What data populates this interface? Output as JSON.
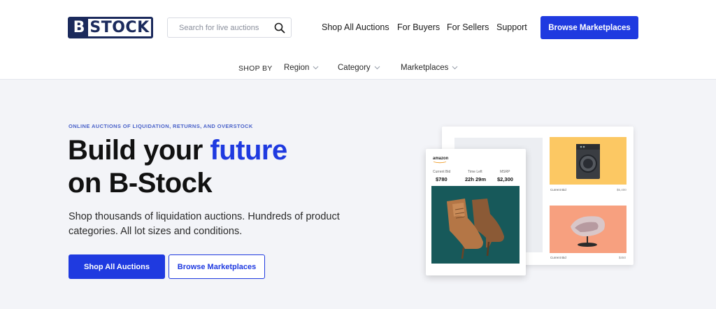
{
  "logo": {
    "letter": "B",
    "rest": "STOCK"
  },
  "search": {
    "placeholder": "Search for live auctions",
    "value": ""
  },
  "nav": {
    "items": [
      "Shop All Auctions",
      "For Buyers",
      "For Sellers",
      "Support"
    ],
    "cta": "Browse Marketplaces"
  },
  "subnav": {
    "label": "SHOP BY",
    "items": [
      "Region",
      "Category",
      "Marketplaces"
    ]
  },
  "hero": {
    "eyebrow": "ONLINE AUCTIONS OF LIQUIDATION, RETURNS, AND OVERSTOCK",
    "headline_part1": "Build your ",
    "headline_accent": "future",
    "headline_part2": "on B-Stock",
    "description": "Shop thousands of liquidation auctions. Hundreds of product categories. All lot sizes and conditions.",
    "primary_button": "Shop All Auctions",
    "secondary_button": "Browse Marketplaces"
  },
  "illustration": {
    "card": {
      "brand": "amazon",
      "stats": [
        {
          "label": "Current Bid",
          "value": "$780"
        },
        {
          "label": "Time Left",
          "value": "22h 29m"
        },
        {
          "label": "MSRP",
          "value": "$2,300"
        }
      ]
    },
    "tiles": [
      {
        "caption": "Current Bid",
        "price": "$5,400"
      },
      {
        "caption": "Current Bid",
        "price": "$450"
      }
    ]
  },
  "colors": {
    "brand_blue": "#1f3ae0",
    "logo_navy": "#1b2a5c",
    "hero_bg": "#f3f4f8",
    "tile_yellow": "#fcc863",
    "tile_salmon": "#f7a07f",
    "product_teal": "#17595a"
  }
}
